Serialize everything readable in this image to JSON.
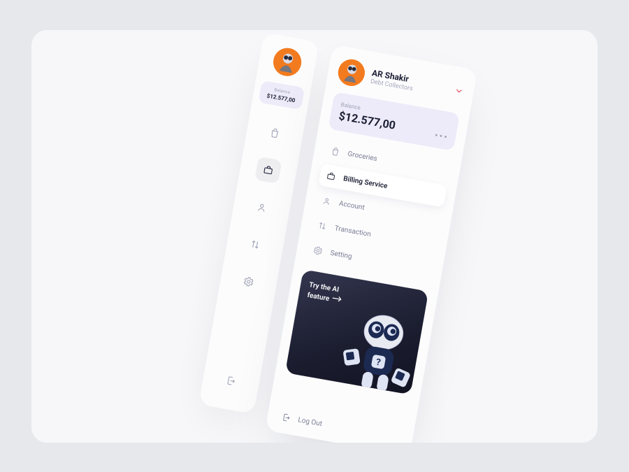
{
  "user": {
    "name": "AR Shakir",
    "role": "Debt Collectors"
  },
  "balance": {
    "label": "Balance",
    "amount": "$12.577,00"
  },
  "nav": {
    "groceries": "Groceries",
    "billing": "Billing Service",
    "account": "Account",
    "transaction": "Transaction",
    "setting": "Setting"
  },
  "promo": {
    "line1": "Try the AI",
    "line2": "feature"
  },
  "logout": "Log Out"
}
